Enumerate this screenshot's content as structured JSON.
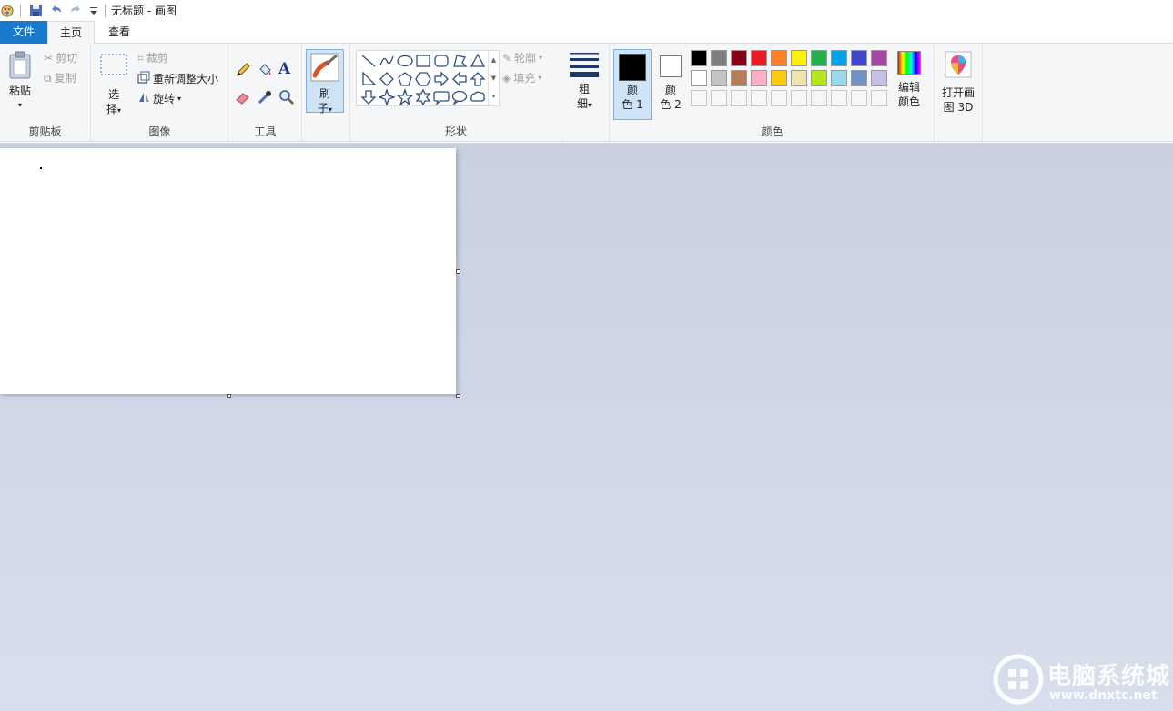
{
  "window": {
    "title": "无标题 - 画图"
  },
  "tabs": {
    "file": "文件",
    "home": "主页",
    "view": "查看"
  },
  "clipboard": {
    "paste": "粘贴",
    "cut": "剪切",
    "copy": "复制",
    "label": "剪贴板"
  },
  "image": {
    "select_line1": "选",
    "select_line2": "择",
    "crop": "裁剪",
    "resize": "重新调整大小",
    "rotate": "旋转",
    "label": "图像"
  },
  "tools": {
    "label": "工具"
  },
  "brush": {
    "line1": "刷",
    "line2": "子"
  },
  "shapes": {
    "outline": "轮廓",
    "fill": "填充",
    "label": "形状"
  },
  "size": {
    "line1": "粗",
    "line2": "细"
  },
  "colors": {
    "color1_line1": "颜",
    "color1_line2": "色 1",
    "color2_line1": "颜",
    "color2_line2": "色 2",
    "edit_line1": "编辑",
    "edit_line2": "颜色",
    "label": "颜色",
    "color1_value": "#000000",
    "color2_value": "#ffffff",
    "palette_row1": [
      "#000000",
      "#7f7f7f",
      "#880015",
      "#ed1c24",
      "#ff7f27",
      "#fff200",
      "#22b14c",
      "#00a2e8",
      "#3f48cc",
      "#a349a4"
    ],
    "palette_row2": [
      "#ffffff",
      "#c3c3c3",
      "#b97a57",
      "#ffaec9",
      "#ffc90e",
      "#efe4b0",
      "#b5e61d",
      "#99d9ea",
      "#7092be",
      "#c8bfe7"
    ]
  },
  "paint3d": {
    "line1": "打开画",
    "line2": "图 3D"
  },
  "watermark": {
    "name": "电脑系统城",
    "url": "www.dnxtc.net"
  }
}
